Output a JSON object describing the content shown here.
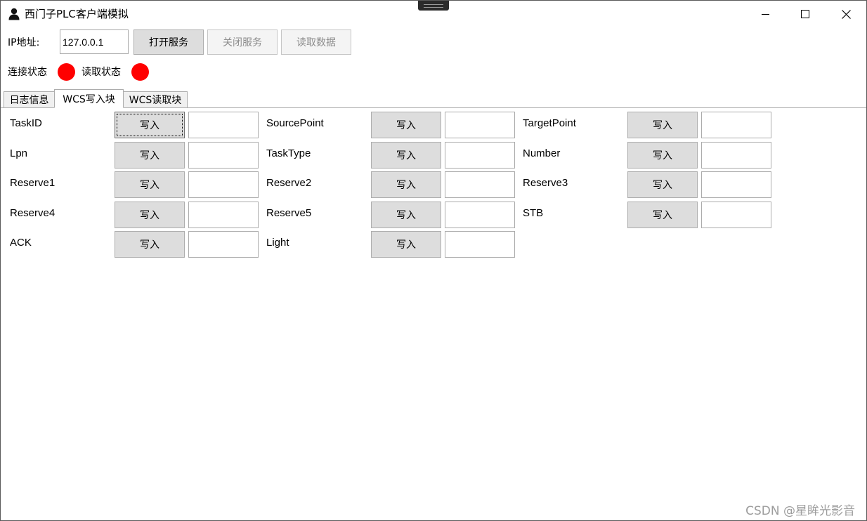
{
  "window": {
    "title": "西门子PLC客户端模拟",
    "icon": "user-icon",
    "controls": [
      "minimize",
      "maximize",
      "close"
    ]
  },
  "connection": {
    "ip_label": "IP地址:",
    "ip_value": "127.0.0.1",
    "open_button": "打开服务",
    "close_button": "关闭服务",
    "read_button": "读取数据"
  },
  "status": {
    "connect_label": "连接状态",
    "read_label": "读取状态",
    "connect_color": "#ff0000",
    "read_color": "#ff0000"
  },
  "tabs": [
    {
      "label": "日志信息",
      "active": false
    },
    {
      "label": "WCS写入块",
      "active": true
    },
    {
      "label": "WCS读取块",
      "active": false
    }
  ],
  "write_button_label": "写入",
  "fields": [
    {
      "label": "TaskID",
      "value": ""
    },
    {
      "label": "SourcePoint",
      "value": ""
    },
    {
      "label": "TargetPoint",
      "value": ""
    },
    {
      "label": "Lpn",
      "value": ""
    },
    {
      "label": "TaskType",
      "value": ""
    },
    {
      "label": "Number",
      "value": ""
    },
    {
      "label": "Reserve1",
      "value": ""
    },
    {
      "label": "Reserve2",
      "value": ""
    },
    {
      "label": "Reserve3",
      "value": ""
    },
    {
      "label": "Reserve4",
      "value": ""
    },
    {
      "label": "Reserve5",
      "value": ""
    },
    {
      "label": "STB",
      "value": ""
    },
    {
      "label": "ACK",
      "value": ""
    },
    {
      "label": "Light",
      "value": ""
    }
  ],
  "watermark": "CSDN @星眸光影音"
}
